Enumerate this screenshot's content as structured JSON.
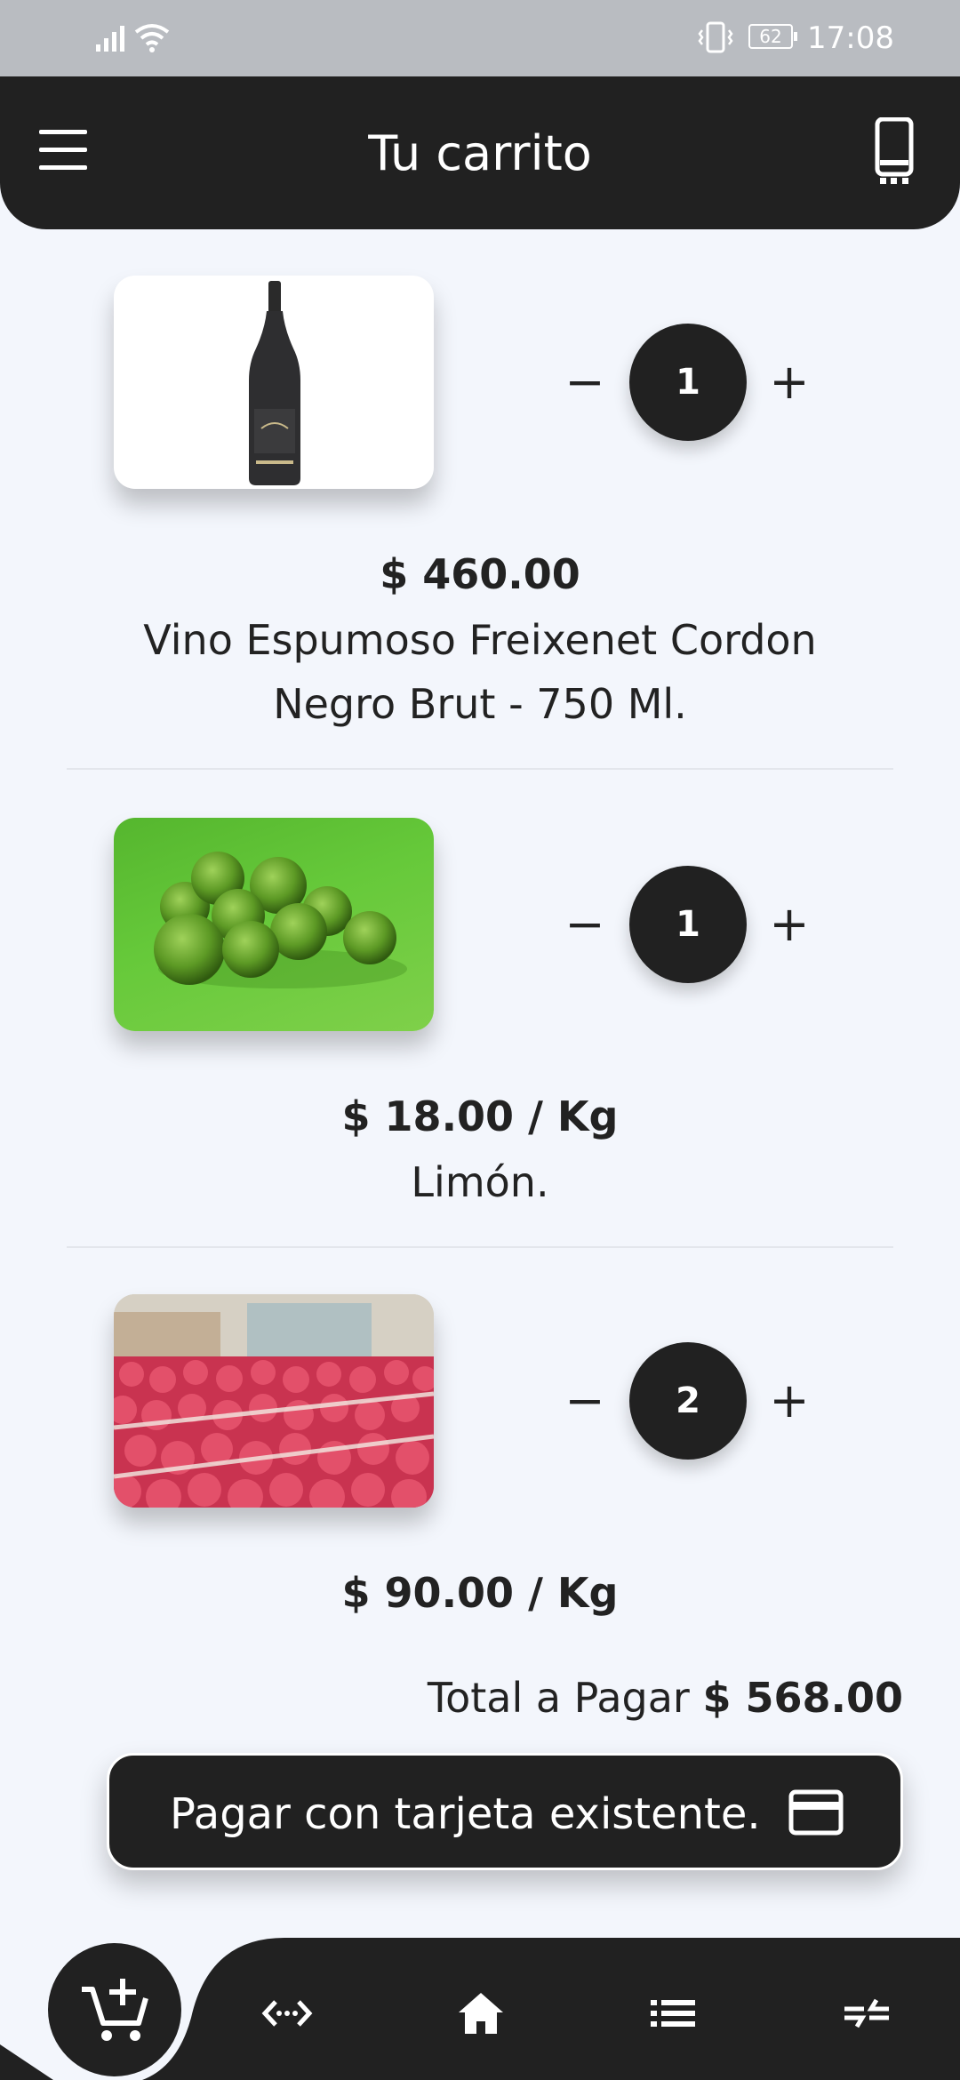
{
  "status_bar": {
    "time": "17:08",
    "battery": "62"
  },
  "header": {
    "title": "Tu carrito"
  },
  "cart_items": [
    {
      "price": "$ 460.00",
      "name": "Vino Espumoso Freixenet Cordon Negro Brut - 750 Ml.",
      "quantity": "1",
      "image": "sparkling-wine-bottle"
    },
    {
      "price": "$ 18.00 / Kg",
      "name": "Limón.",
      "quantity": "1",
      "image": "limes"
    },
    {
      "price": "$ 90.00 / Kg",
      "name": "",
      "quantity": "2",
      "image": "raspberries"
    }
  ],
  "qty_controls": {
    "minus": "−",
    "plus": "+"
  },
  "total": {
    "label": "Total a Pagar",
    "amount": "$ 568.00"
  },
  "pay_button": {
    "label": "Pagar con tarjeta existente.",
    "icon": "credit-card-icon"
  },
  "bottom_nav": {
    "items": [
      "add-cart-icon",
      "code-arrows-icon",
      "home-icon",
      "list-icon",
      "compress-icon"
    ]
  },
  "colors": {
    "dark": "#212121",
    "background": "#f3f6fc",
    "status_bar": "#b9bcc1"
  }
}
